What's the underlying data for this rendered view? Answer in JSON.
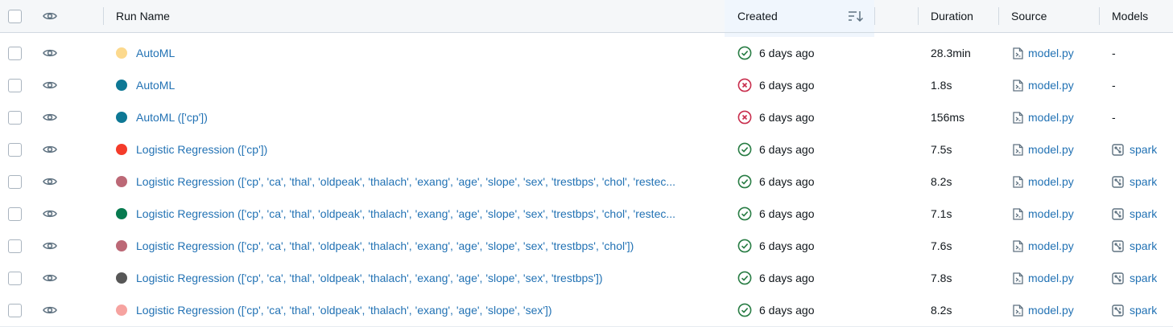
{
  "header": {
    "run_name": "Run Name",
    "created": "Created",
    "duration": "Duration",
    "source": "Source",
    "models": "Models"
  },
  "colors": {
    "link": "#2272b4",
    "success": "#277c43",
    "error": "#c82d4c"
  },
  "rows": [
    {
      "name": "AutoML",
      "color": "#fcd98d",
      "status": "success",
      "created": "6 days ago",
      "duration": "28.3min",
      "source": "model.py",
      "model": "-",
      "has_model": false
    },
    {
      "name": "AutoML",
      "color": "#0e7895",
      "status": "error",
      "created": "6 days ago",
      "duration": "1.8s",
      "source": "model.py",
      "model": "-",
      "has_model": false
    },
    {
      "name": "AutoML (['cp'])",
      "color": "#0e7895",
      "status": "error",
      "created": "6 days ago",
      "duration": "156ms",
      "source": "model.py",
      "model": "-",
      "has_model": false
    },
    {
      "name": "Logistic Regression (['cp'])",
      "color": "#f43b2a",
      "status": "success",
      "created": "6 days ago",
      "duration": "7.5s",
      "source": "model.py",
      "model": "spark",
      "has_model": true
    },
    {
      "name": "Logistic Regression (['cp', 'ca', 'thal', 'oldpeak', 'thalach', 'exang', 'age', 'slope', 'sex', 'trestbps', 'chol', 'restec...",
      "color": "#bc6876",
      "status": "success",
      "created": "6 days ago",
      "duration": "8.2s",
      "source": "model.py",
      "model": "spark",
      "has_model": true
    },
    {
      "name": "Logistic Regression (['cp', 'ca', 'thal', 'oldpeak', 'thalach', 'exang', 'age', 'slope', 'sex', 'trestbps', 'chol', 'restec...",
      "color": "#077a4f",
      "status": "success",
      "created": "6 days ago",
      "duration": "7.1s",
      "source": "model.py",
      "model": "spark",
      "has_model": true
    },
    {
      "name": "Logistic Regression (['cp', 'ca', 'thal', 'oldpeak', 'thalach', 'exang', 'age', 'slope', 'sex', 'trestbps', 'chol'])",
      "color": "#bc6876",
      "status": "success",
      "created": "6 days ago",
      "duration": "7.6s",
      "source": "model.py",
      "model": "spark",
      "has_model": true
    },
    {
      "name": "Logistic Regression (['cp', 'ca', 'thal', 'oldpeak', 'thalach', 'exang', 'age', 'slope', 'sex', 'trestbps'])",
      "color": "#575757",
      "status": "success",
      "created": "6 days ago",
      "duration": "7.8s",
      "source": "model.py",
      "model": "spark",
      "has_model": true
    },
    {
      "name": "Logistic Regression (['cp', 'ca', 'thal', 'oldpeak', 'thalach', 'exang', 'age', 'slope', 'sex'])",
      "color": "#f6a3a0",
      "status": "success",
      "created": "6 days ago",
      "duration": "8.2s",
      "source": "model.py",
      "model": "spark",
      "has_model": true
    }
  ]
}
